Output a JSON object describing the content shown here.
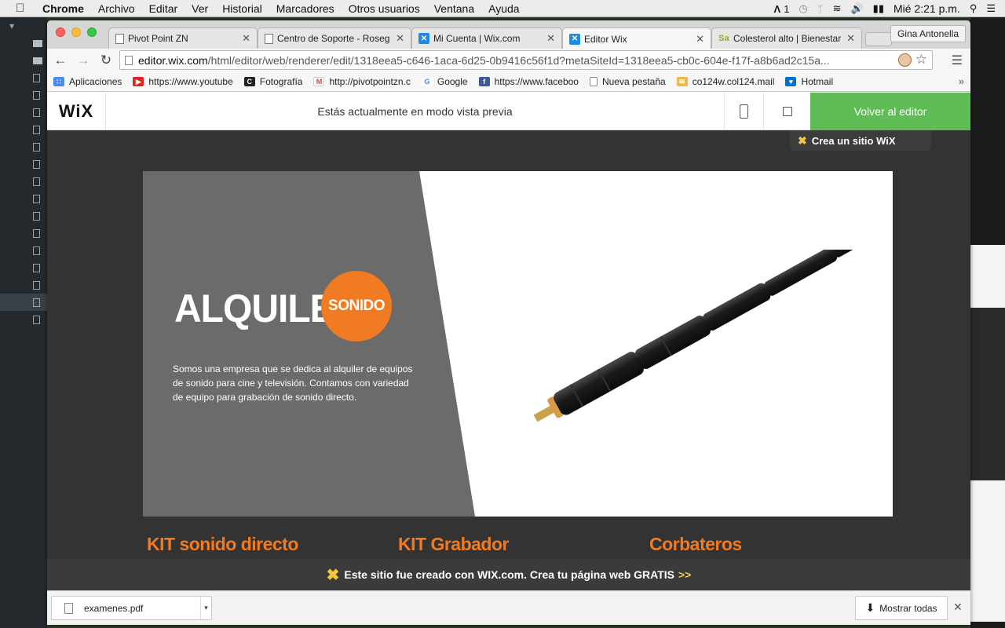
{
  "menubar": {
    "app": "Chrome",
    "items": [
      "Archivo",
      "Editar",
      "Ver",
      "Historial",
      "Marcadores",
      "Otros usuarios",
      "Ventana",
      "Ayuda"
    ],
    "status_count": "1",
    "clock": "Mié 2:21 p.m."
  },
  "tabs": [
    {
      "title": "Pivot Point ZN",
      "icon": "page-icon"
    },
    {
      "title": "Centro de Soporte - Roseg",
      "icon": "page-icon"
    },
    {
      "title": "Mi Cuenta | Wix.com",
      "icon": "wix-icon"
    },
    {
      "title": "Editor Wix",
      "icon": "wix-icon",
      "active": true
    },
    {
      "title": "Colesterol alto | Bienestar",
      "icon": "sa-icon",
      "fav_text": "Sa"
    }
  ],
  "profile": "Gina Antonella",
  "address": {
    "host": "editor.wix.com",
    "path": "/html/editor/web/renderer/edit/1318eea5-c646-1aca-6d25-0b9416c56f1d?metaSiteId=1318eea5-cb0c-604e-f17f-a8b6ad2c15a..."
  },
  "bookmarks": [
    {
      "label": "Aplicaciones",
      "icon": "apps-icon",
      "color": "#4a8af4"
    },
    {
      "label": "https://www.youtube",
      "icon": "youtube-icon",
      "color": "#e62117"
    },
    {
      "label": "Fotografía",
      "icon": "camera-icon",
      "color": "#222222"
    },
    {
      "label": "http://pivotpointzn.c",
      "icon": "gmail-icon",
      "color": "#d44638"
    },
    {
      "label": "Google",
      "icon": "google-icon",
      "color": "#4285f4"
    },
    {
      "label": "https://www.faceboo",
      "icon": "facebook-icon",
      "color": "#3b5998"
    },
    {
      "label": "Nueva pestaña",
      "icon": "page-icon",
      "color": "#ffffff"
    },
    {
      "label": "co124w.col124.mail",
      "icon": "mail-icon",
      "color": "#e8b84a"
    },
    {
      "label": "Hotmail",
      "icon": "hotmail-icon",
      "color": "#0072c6"
    }
  ],
  "wixbar": {
    "logo": "WiX",
    "message": "Estás actualmente en modo vista previa",
    "back_label": "Volver al editor"
  },
  "crea_badge": "Crea un sitio WiX",
  "hero": {
    "title": "ALQUILER",
    "badge": "SONIDO",
    "description": "Somos una empresa que se dedica al alquiler de equipos de sonido para cine y televisión. Contamos con variedad de equipo para grabación de sonido directo."
  },
  "links": [
    "KIT sonido directo",
    "KIT Grabador",
    "Corbateros"
  ],
  "footer": {
    "text": "Este sitio fue creado con WIX.com. Crea tu página web GRATIS",
    "arrows": ">>"
  },
  "downloads": {
    "file": "examenes.pdf",
    "show_all": "Mostrar todas"
  },
  "colors": {
    "accent_orange": "#f07b22",
    "wix_green": "#60bc57",
    "hero_gray": "#6b6b6b",
    "page_bg": "#333333"
  }
}
